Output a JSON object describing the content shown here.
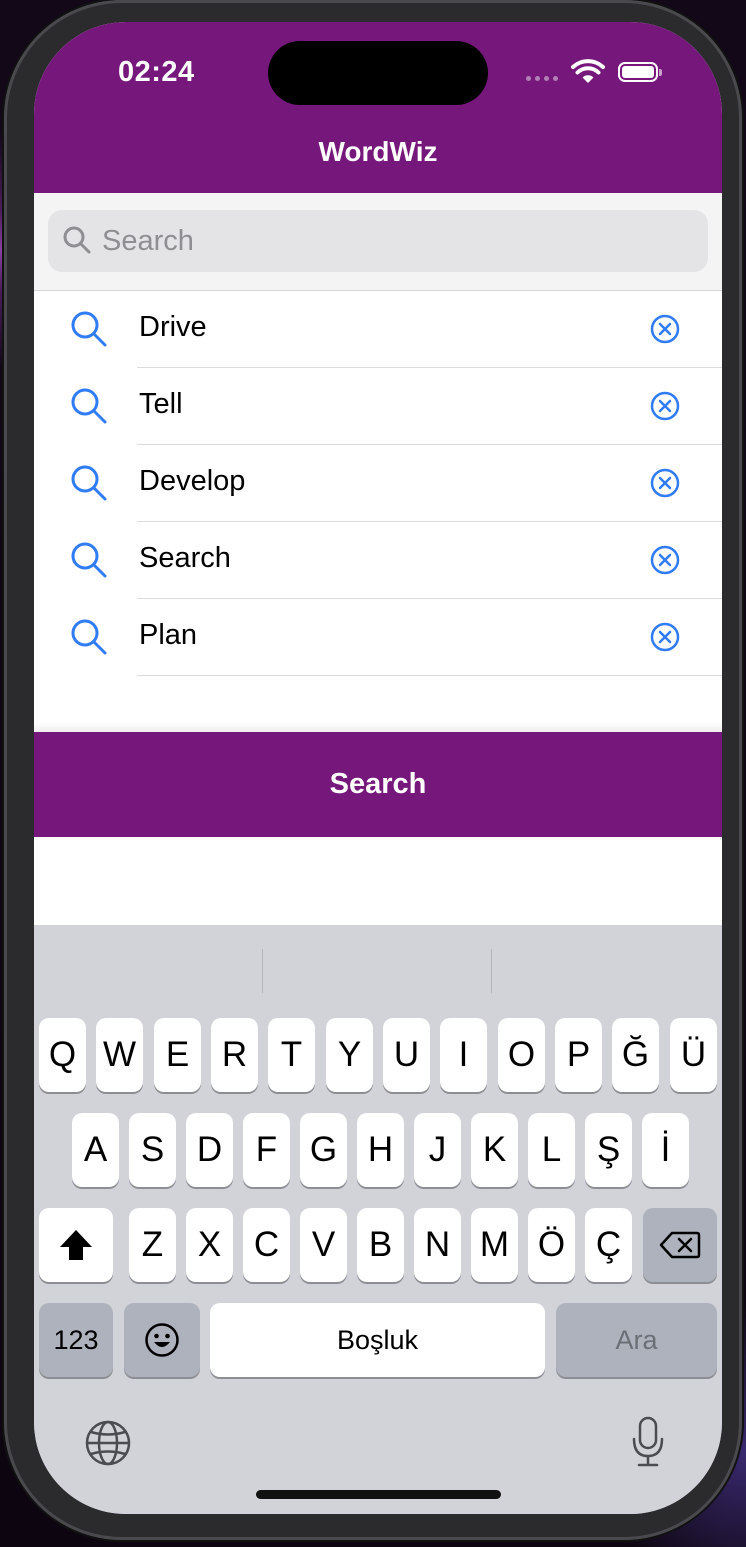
{
  "status_bar": {
    "time": "02:24"
  },
  "nav": {
    "title": "WordWiz"
  },
  "search": {
    "placeholder": "Search",
    "value": ""
  },
  "recent_searches": [
    {
      "label": "Drive"
    },
    {
      "label": "Tell"
    },
    {
      "label": "Develop"
    },
    {
      "label": "Search"
    },
    {
      "label": "Plan"
    }
  ],
  "search_button": {
    "label": "Search"
  },
  "keyboard": {
    "row1": [
      "Q",
      "W",
      "E",
      "R",
      "T",
      "Y",
      "U",
      "I",
      "O",
      "P",
      "Ğ",
      "Ü"
    ],
    "row2": [
      "A",
      "S",
      "D",
      "F",
      "G",
      "H",
      "J",
      "K",
      "L",
      "Ş",
      "İ"
    ],
    "row3": [
      "Z",
      "X",
      "C",
      "V",
      "B",
      "N",
      "M",
      "Ö",
      "Ç"
    ],
    "numbers_label": "123",
    "space_label": "Boşluk",
    "return_label": "Ara"
  },
  "colors": {
    "accent": "#76177c",
    "link_blue": "#2f7cf6",
    "keyboard_bg": "#d1d3d9"
  },
  "icons": [
    "search-icon",
    "clear-icon",
    "shift-icon",
    "delete-icon",
    "emoji-icon",
    "globe-icon",
    "microphone-icon",
    "wifi-icon",
    "battery-icon"
  ]
}
